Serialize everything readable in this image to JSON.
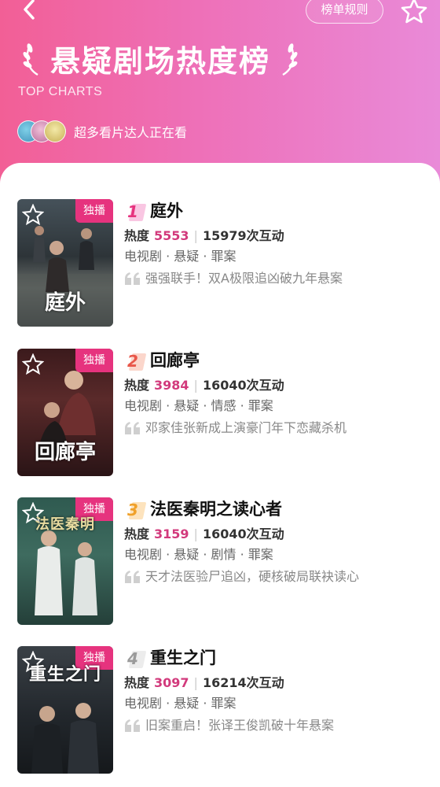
{
  "header": {
    "rules_label": "榜单规则",
    "title": "悬疑剧场热度榜",
    "subtitle": "TOP CHARTS",
    "viewers_text": "超多看片达人正在看"
  },
  "colors": {
    "accent": "#e6337e",
    "heat_value": "#d23a7c",
    "rank1": "#f29ad0",
    "rank2": "#f4b7a6",
    "rank3": "#f7c27a",
    "rank4": "#dddddd"
  },
  "badge_label": "独播",
  "heat_label": "热度",
  "interaction_suffix": "次互动",
  "items": [
    {
      "rank": "1",
      "name": "庭外",
      "heat": "5553",
      "interactions": "15979",
      "tags": "电视剧 · 悬疑 · 罪案",
      "quote": "强强联手！双A极限追凶破九年悬案",
      "poster_title": "庭外"
    },
    {
      "rank": "2",
      "name": "回廊亭",
      "heat": "3984",
      "interactions": "16040",
      "tags": "电视剧 · 悬疑 · 情感 · 罪案",
      "quote": "邓家佳张新成上演豪门年下恋藏杀机",
      "poster_title": "回廊亭"
    },
    {
      "rank": "3",
      "name": "法医秦明之读心者",
      "heat": "3159",
      "interactions": "16040",
      "tags": "电视剧 · 悬疑 · 剧情 · 罪案",
      "quote": "天才法医验尸追凶，硬核破局联袂读心",
      "poster_title": "法医秦明"
    },
    {
      "rank": "4",
      "name": "重生之门",
      "heat": "3097",
      "interactions": "16214",
      "tags": "电视剧 · 悬疑 · 罪案",
      "quote": "旧案重启！张译王俊凯破十年悬案",
      "poster_title": "重生之门"
    }
  ]
}
